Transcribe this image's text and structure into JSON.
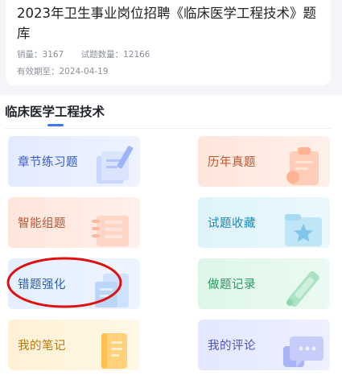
{
  "product": {
    "title": "2023年卫生事业岗位招聘《临床医学工程技术》题库",
    "sales_label": "销量：3167",
    "question_count_label": "试题数量：12166",
    "valid_until_label": "有效期至：2024-04-19"
  },
  "section": {
    "title": "临床医学工程技术"
  },
  "menu": {
    "items": [
      {
        "label": "章节练习题",
        "icon": "book-pen-icon"
      },
      {
        "label": "历年真题",
        "icon": "clipboard-icon"
      },
      {
        "label": "智能组题",
        "icon": "list-sheet-icon"
      },
      {
        "label": "试题收藏",
        "icon": "star-folder-icon"
      },
      {
        "label": "错题强化",
        "icon": "document-icon"
      },
      {
        "label": "做题记录",
        "icon": "pencil-icon"
      },
      {
        "label": "我的笔记",
        "icon": "notebook-icon"
      },
      {
        "label": "我的评论",
        "icon": "comment-icon"
      }
    ]
  },
  "colors": {
    "accent": "#3b7cf0",
    "annotation": "#e01010"
  }
}
